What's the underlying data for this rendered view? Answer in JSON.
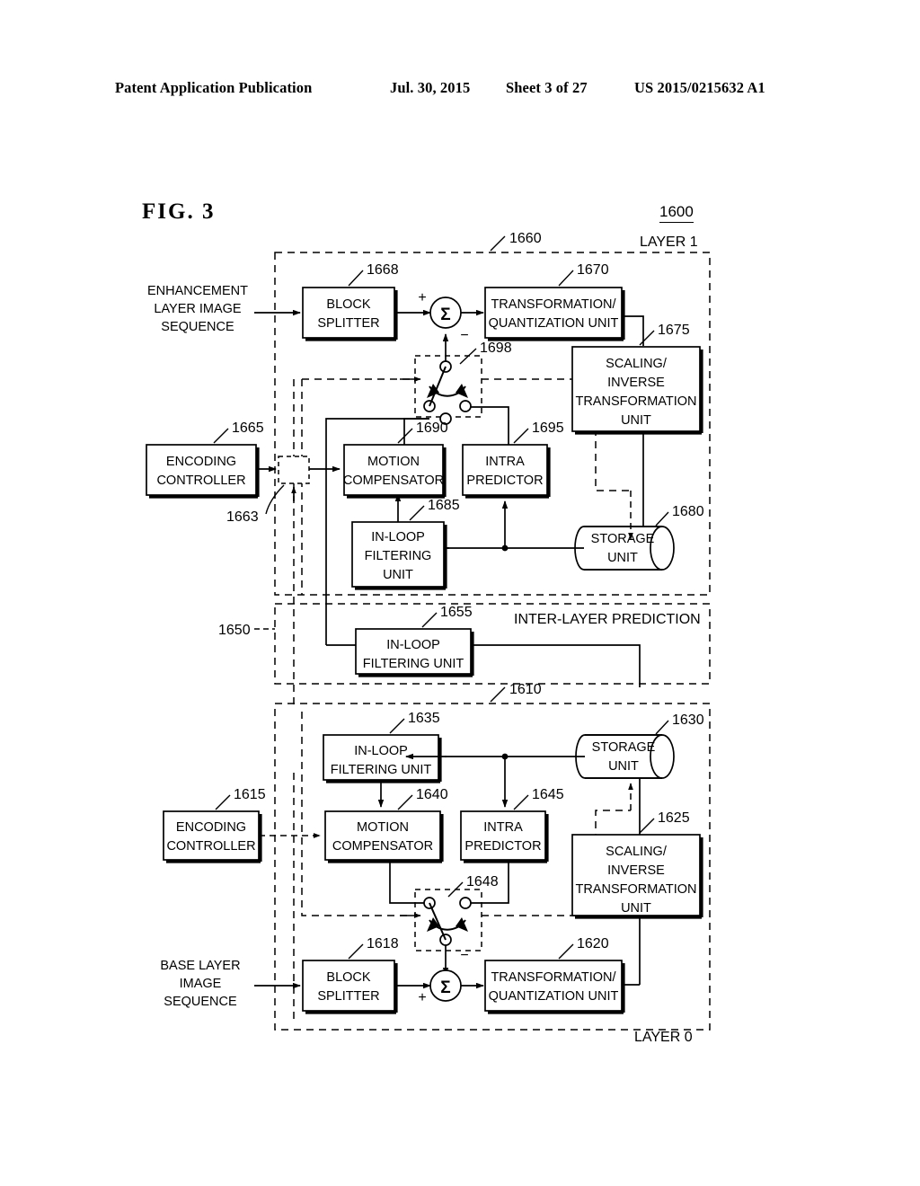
{
  "header": {
    "publication": "Patent Application Publication",
    "date": "Jul. 30, 2015",
    "sheet": "Sheet 3 of 27",
    "number": "US 2015/0215632 A1"
  },
  "figure": {
    "label": "FIG.  3",
    "top_ref": "1600"
  },
  "layers": {
    "layer1_label": "LAYER 1",
    "layer0_label": "LAYER 0",
    "interlayer_label": "INTER-LAYER PREDICTION",
    "layer1_ref": "1660",
    "layer0_ref": "1610",
    "interlayer_ref": "1650"
  },
  "inputs": {
    "enhancement": "ENHANCEMENT\nLAYER IMAGE\nSEQUENCE",
    "enhancement_l1": "ENHANCEMENT",
    "enhancement_l2": "LAYER IMAGE",
    "enhancement_l3": "SEQUENCE",
    "base_l1": "BASE LAYER",
    "base_l2": "IMAGE",
    "base_l3": "SEQUENCE"
  },
  "blocks": {
    "block_splitter_top": {
      "line1": "BLOCK",
      "line2": "SPLITTER",
      "ref": "1668"
    },
    "transform_quant_top": {
      "line1": "TRANSFORMATION/",
      "line2": "QUANTIZATION UNIT",
      "ref": "1670"
    },
    "scaling_inverse_top": {
      "line1": "SCALING/",
      "line2": "INVERSE",
      "line3": "TRANSFORMATION",
      "line4": "UNIT",
      "ref": "1675"
    },
    "storage_top": {
      "line1": "STORAGE",
      "line2": "UNIT",
      "ref": "1680"
    },
    "encoding_controller_top": {
      "line1": "ENCODING",
      "line2": "CONTROLLER",
      "ref": "1665"
    },
    "motion_comp_top": {
      "line1": "MOTION",
      "line2": "COMPENSATOR",
      "ref": "1690"
    },
    "intra_pred_top": {
      "line1": "INTRA",
      "line2": "PREDICTOR",
      "ref": "1695"
    },
    "inloop_top": {
      "line1": "IN-LOOP",
      "line2": "FILTERING",
      "line3": "UNIT",
      "ref": "1685"
    },
    "switch_top": {
      "ref": "1698"
    },
    "mux_top": {
      "ref": "1663"
    },
    "inloop_mid": {
      "line1": "IN-LOOP",
      "line2": "FILTERING UNIT",
      "ref": "1655"
    },
    "inloop_bottom": {
      "line1": "IN-LOOP",
      "line2": "FILTERING UNIT",
      "ref": "1635"
    },
    "storage_bottom": {
      "line1": "STORAGE",
      "line2": "UNIT",
      "ref": "1630"
    },
    "encoding_controller_bottom": {
      "line1": "ENCODING",
      "line2": "CONTROLLER",
      "ref": "1615"
    },
    "motion_comp_bottom": {
      "line1": "MOTION",
      "line2": "COMPENSATOR",
      "ref": "1640"
    },
    "intra_pred_bottom": {
      "line1": "INTRA",
      "line2": "PREDICTOR",
      "ref": "1645"
    },
    "scaling_inverse_bottom": {
      "line1": "SCALING/",
      "line2": "INVERSE",
      "line3": "TRANSFORMATION",
      "line4": "UNIT",
      "ref": "1625"
    },
    "switch_bottom": {
      "ref": "1648"
    },
    "block_splitter_bottom": {
      "line1": "BLOCK",
      "line2": "SPLITTER",
      "ref": "1618"
    },
    "transform_quant_bottom": {
      "line1": "TRANSFORMATION/",
      "line2": "QUANTIZATION UNIT",
      "ref": "1620"
    }
  },
  "symbols": {
    "sigma": "Σ",
    "plus": "+",
    "minus": "−"
  },
  "colors": {
    "line": "#000000",
    "background": "#ffffff"
  }
}
